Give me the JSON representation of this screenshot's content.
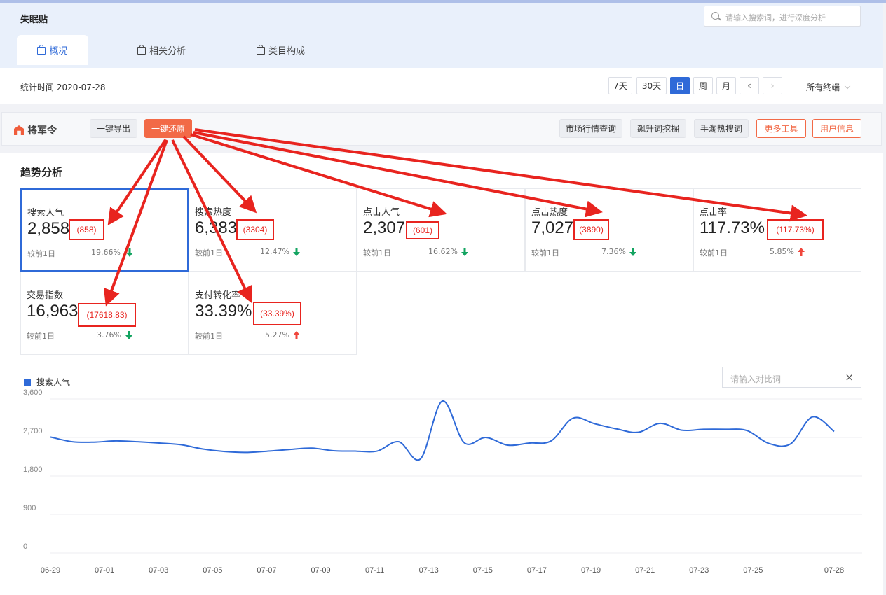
{
  "app_title": "失眠贴",
  "search_placeholder": "请输入搜索词，进行深度分析",
  "tabs": [
    {
      "label": "概况",
      "active": true
    },
    {
      "label": "相关分析",
      "active": false
    },
    {
      "label": "类目构成",
      "active": false
    }
  ],
  "stat_time": "统计时间 2020-07-28",
  "periods": [
    "7天",
    "30天",
    "日",
    "周",
    "月"
  ],
  "active_period": "日",
  "terminal": "所有终端",
  "toolbar": {
    "logo": "将军令",
    "export": "一键导出",
    "restore": "一键还原",
    "market": "市场行情查询",
    "soaring": "飙升词挖掘",
    "hot": "手淘热搜词",
    "more": "更多工具",
    "user": "用户信息"
  },
  "section_title": "趋势分析",
  "metrics": [
    {
      "label": "搜索人气",
      "value": "2,858",
      "restored": "(858)",
      "compare": "较前1日",
      "pct": "19.66%",
      "dir": "down"
    },
    {
      "label": "搜索热度",
      "value": "6,383",
      "restored": "(3304)",
      "compare": "较前1日",
      "pct": "12.47%",
      "dir": "down"
    },
    {
      "label": "点击人气",
      "value": "2,307",
      "restored": "(601)",
      "compare": "较前1日",
      "pct": "16.62%",
      "dir": "down"
    },
    {
      "label": "点击热度",
      "value": "7,027",
      "restored": "(3890)",
      "compare": "较前1日",
      "pct": "7.36%",
      "dir": "down"
    },
    {
      "label": "点击率",
      "value": "117.73%",
      "restored": "(117.73%)",
      "compare": "较前1日",
      "pct": "5.85%",
      "dir": "up"
    },
    {
      "label": "交易指数",
      "value": "16,963",
      "restored": "(17618.83)",
      "compare": "较前1日",
      "pct": "3.76%",
      "dir": "down"
    },
    {
      "label": "支付转化率",
      "value": "33.39%",
      "restored": "(33.39%)",
      "compare": "较前1日",
      "pct": "5.27%",
      "dir": "up"
    }
  ],
  "compare_placeholder": "请输入对比词",
  "close_glyph": "×",
  "colors": {
    "accent": "#2f6ad8",
    "annotation": "#e8241f",
    "orange": "#f26a47",
    "down": "#13a461",
    "up": "#f0463c"
  },
  "chart_data": {
    "type": "line",
    "series": [
      {
        "name": "搜索人气",
        "values": [
          2710,
          2600,
          2590,
          2620,
          2600,
          2570,
          2530,
          2430,
          2370,
          2350,
          2380,
          2420,
          2450,
          2390,
          2380,
          2380,
          2600,
          2200,
          3550,
          2580,
          2700,
          2520,
          2570,
          2620,
          3150,
          3020,
          2900,
          2820,
          3030,
          2870,
          2890,
          2890,
          2860,
          2560,
          2550,
          3180,
          2840
        ]
      }
    ],
    "dates": [
      "06-29",
      "06-30",
      "07-01",
      "07-02",
      "07-03",
      "07-04",
      "07-05",
      "07-06",
      "07-07",
      "07-08",
      "07-09",
      "07-10",
      "07-11",
      "07-12",
      "07-13",
      "07-14",
      "07-15",
      "07-16",
      "07-17",
      "07-18",
      "07-19",
      "07-20",
      "07-21",
      "07-22",
      "07-23",
      "07-24",
      "07-25",
      "07-26",
      "07-27",
      "07-28"
    ],
    "xtick_labels": [
      "06-29",
      "07-01",
      "07-03",
      "07-05",
      "07-07",
      "07-09",
      "07-11",
      "07-13",
      "07-15",
      "07-17",
      "07-19",
      "07-21",
      "07-23",
      "07-25",
      "07-28"
    ],
    "ytick_labels": [
      "3,600",
      "2,700",
      "1,800",
      "900",
      "0"
    ],
    "ylim": [
      0,
      3600
    ],
    "grid": true,
    "legend": "top-left"
  }
}
